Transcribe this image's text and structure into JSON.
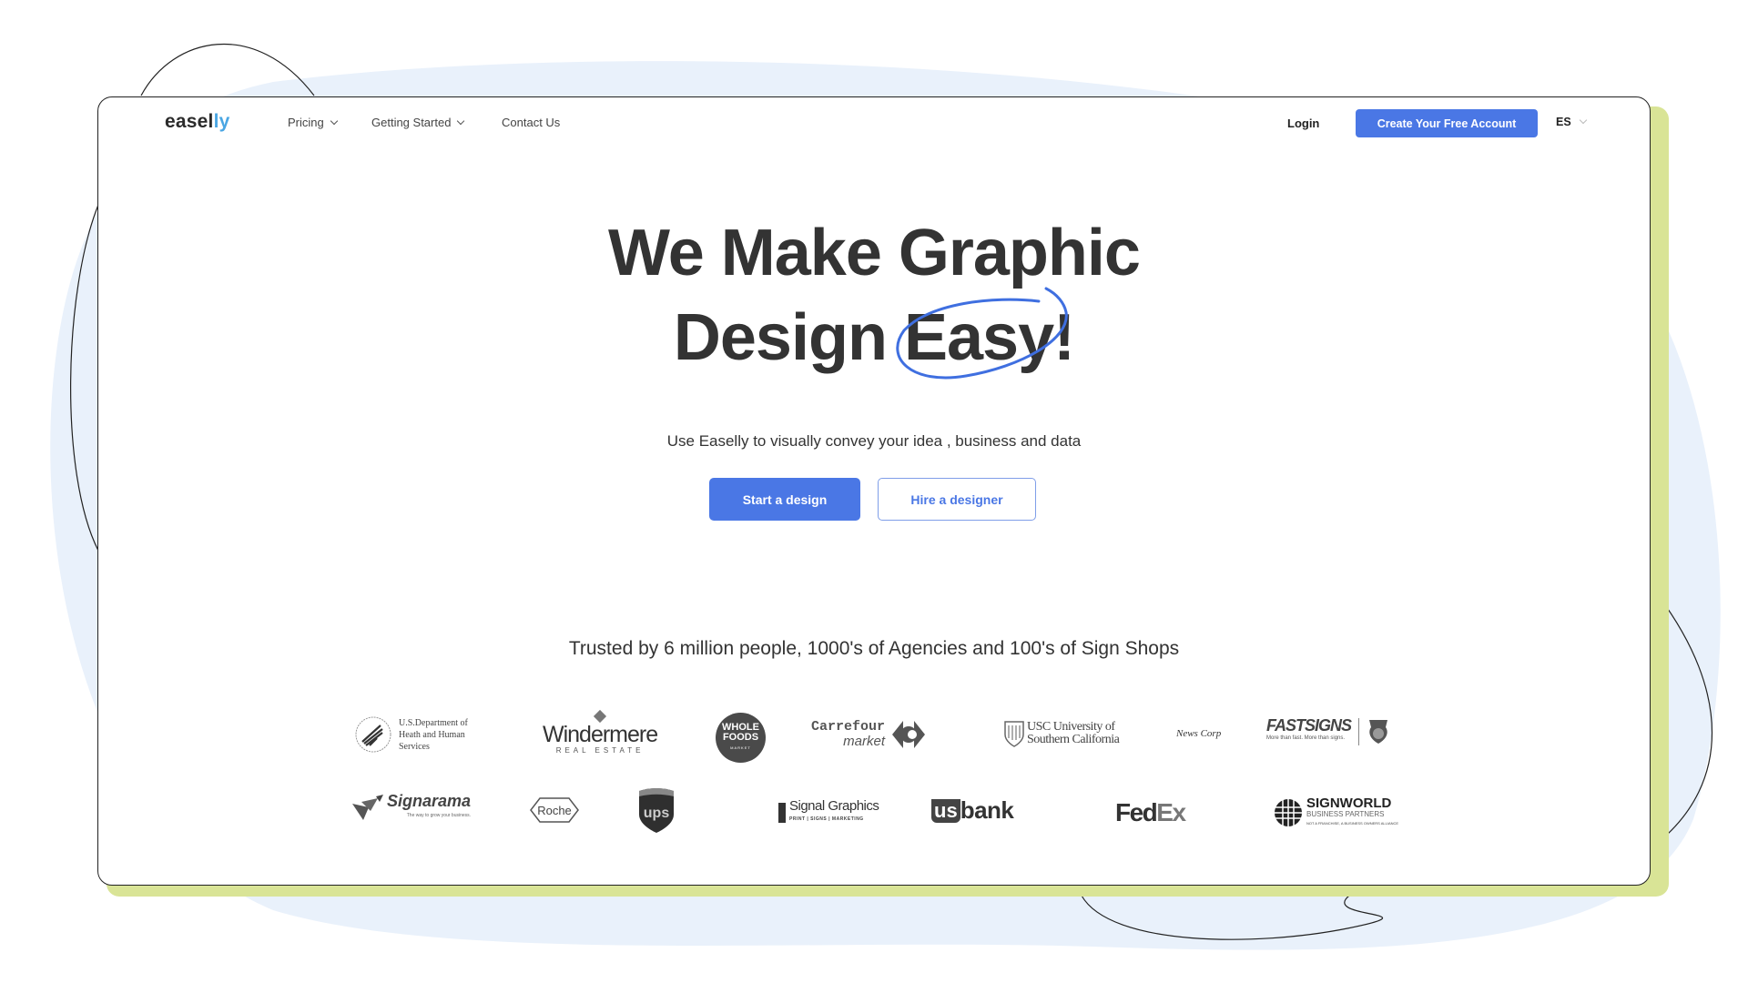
{
  "nav": {
    "logo_main": "easel",
    "logo_accent": "ly",
    "items": [
      {
        "label": "Pricing",
        "has_dropdown": true
      },
      {
        "label": "Getting Started",
        "has_dropdown": true
      },
      {
        "label": "Contact Us",
        "has_dropdown": false
      }
    ],
    "login_label": "Login",
    "cta_label": "Create Your Free Account",
    "language": "ES"
  },
  "hero": {
    "title_line1": "We Make Graphic",
    "title_line2_prefix": "Design",
    "title_highlight": "Easy!",
    "subtitle": "Use Easelly to visually convey your idea , business and data",
    "primary_button": "Start a design",
    "secondary_button": "Hire a designer"
  },
  "trusted": {
    "heading": "Trusted by 6 million people, 1000's of Agencies and 100's of Sign Shops",
    "logos_row1": [
      {
        "name": "hhs",
        "lines": [
          "U.S.Department of",
          "Heath and Human",
          "Services"
        ]
      },
      {
        "name": "windermere",
        "main": "Windermere",
        "sub": "REAL ESTATE"
      },
      {
        "name": "whole-foods",
        "lines": [
          "WHOLE",
          "FOODS",
          "MARKET"
        ]
      },
      {
        "name": "carrefour",
        "main": "Carrefour",
        "sub": "market"
      },
      {
        "name": "usc",
        "main": "USC University of",
        "sub": "Southern California"
      },
      {
        "name": "news-corp",
        "main": "News Corp"
      },
      {
        "name": "fastsigns",
        "main": "FASTSIGNS",
        "sub": "More than fast. More than signs."
      }
    ],
    "logos_row2": [
      {
        "name": "signarama",
        "main": "Signarama",
        "sub": "The way to grow your business."
      },
      {
        "name": "roche",
        "main": "Roche"
      },
      {
        "name": "ups",
        "main": "ups"
      },
      {
        "name": "signal-graphics",
        "main": "Signal Graphics",
        "sub": "PRINT | SIGNS | MARKETING"
      },
      {
        "name": "usbank",
        "prefix": "us",
        "main": "bank"
      },
      {
        "name": "fedex",
        "main": "Fed",
        "accent": "Ex"
      },
      {
        "name": "signworld",
        "main": "SIGNWORLD",
        "sub": "BUSINESS PARTNERS",
        "tag": "NOT A FRANCHISE, A BUSINESS OWNERS ALLIANCE"
      }
    ]
  },
  "colors": {
    "accent": "#4a77e5",
    "logo_accent": "#4aa6e3",
    "card_shadow": "#d9e496",
    "background_blob": "#e9f1fb"
  }
}
